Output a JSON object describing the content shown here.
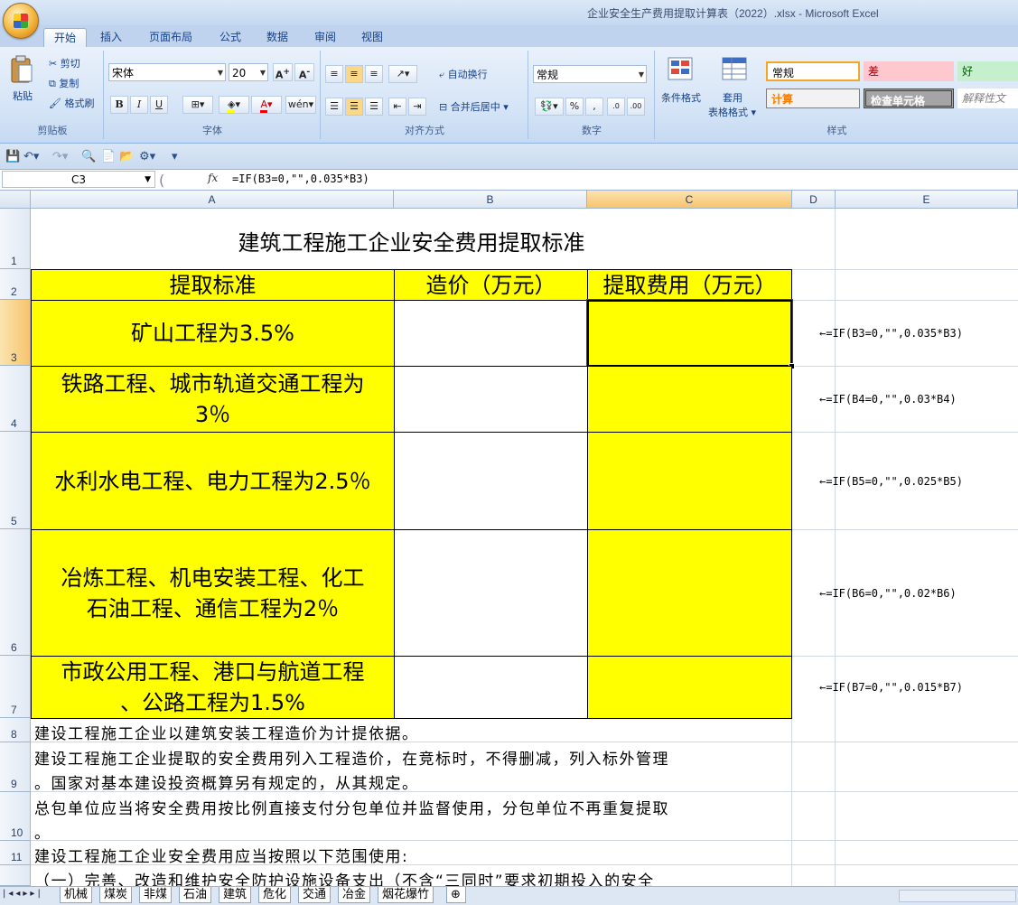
{
  "window": {
    "title": "企业安全生产费用提取计算表（2022）.xlsx - Microsoft Excel"
  },
  "ribbon": {
    "tabs": [
      "开始",
      "插入",
      "页面布局",
      "公式",
      "数据",
      "审阅",
      "视图"
    ],
    "clipboard": {
      "paste": "粘贴",
      "cut": "剪切",
      "copy": "复制",
      "format_painter": "格式刷",
      "label": "剪贴板"
    },
    "font": {
      "name": "宋体",
      "size": "20",
      "label": "字体"
    },
    "alignment": {
      "wrap": "自动换行",
      "merge": "合并后居中",
      "label": "对齐方式"
    },
    "number": {
      "format": "常规",
      "label": "数字"
    },
    "styles": {
      "conditional": "条件格式",
      "table_format": "套用\n表格格式",
      "normal": "常规",
      "bad": "差",
      "good": "好",
      "calc": "计算",
      "check": "检查单元格",
      "explain": "解释性文",
      "label": "样式"
    }
  },
  "formula_bar": {
    "name_box": "C3",
    "fx": "fx",
    "formula": "=IF(B3=0,\"\",0.035*B3)"
  },
  "columns": [
    "A",
    "B",
    "C",
    "D",
    "E"
  ],
  "rows": [
    "1",
    "2",
    "3",
    "4",
    "5",
    "6",
    "7",
    "8",
    "9",
    "10",
    "11"
  ],
  "sheet": {
    "title": "建筑工程施工企业安全费用提取标准",
    "headers": [
      "提取标准",
      "造价（万元）",
      "提取费用（万元）"
    ],
    "standards": [
      [
        "矿山工程为3.5%"
      ],
      [
        "铁路工程、城市轨道交通工程为",
        "3％"
      ],
      [
        "水利水电工程、电力工程为2.5％"
      ],
      [
        "冶炼工程、机电安装工程、化工",
        "石油工程、通信工程为2％"
      ],
      [
        "市政公用工程、港口与航道工程",
        "、公路工程为1.5%"
      ]
    ],
    "formulas": [
      "←=IF(B3=0,\"\",0.035*B3)",
      "←=IF(B4=0,\"\",0.03*B4)",
      "←=IF(B5=0,\"\",0.025*B5)",
      "←=IF(B6=0,\"\",0.02*B6)",
      "←=IF(B7=0,\"\",0.015*B7)"
    ],
    "notes": [
      "建设工程施工企业以建筑安装工程造价为计提依据。",
      "建设工程施工企业提取的安全费用列入工程造价，在竞标时，不得删减，列入标外管理",
      "。国家对基本建设投资概算另有规定的，从其规定。",
      "总包单位应当将安全费用按比例直接支付分包单位并监督使用，分包单位不再重复提取",
      "。",
      "建设工程施工企业安全费用应当按照以下范围使用:",
      "（一）完善、改造和维护安全防护设施设备支出（不含“三同时”要求初期投入的安全"
    ]
  },
  "sheet_tabs": [
    "机械",
    "煤炭",
    "非煤",
    "石油",
    "建筑",
    "危化",
    "交通",
    "冶金",
    "烟花爆竹"
  ],
  "chart_data": {
    "type": "table",
    "title": "建筑工程施工企业安全费用提取标准",
    "columns": [
      "提取标准",
      "造价（万元）",
      "提取费用（万元）"
    ],
    "rows": [
      [
        "矿山工程为3.5%",
        "",
        ""
      ],
      [
        "铁路工程、城市轨道交通工程为3％",
        "",
        ""
      ],
      [
        "水利水电工程、电力工程为2.5％",
        "",
        ""
      ],
      [
        "冶炼工程、机电安装工程、化工石油工程、通信工程为2％",
        "",
        ""
      ],
      [
        "市政公用工程、港口与航道工程、公路工程为1.5%",
        "",
        ""
      ]
    ]
  }
}
